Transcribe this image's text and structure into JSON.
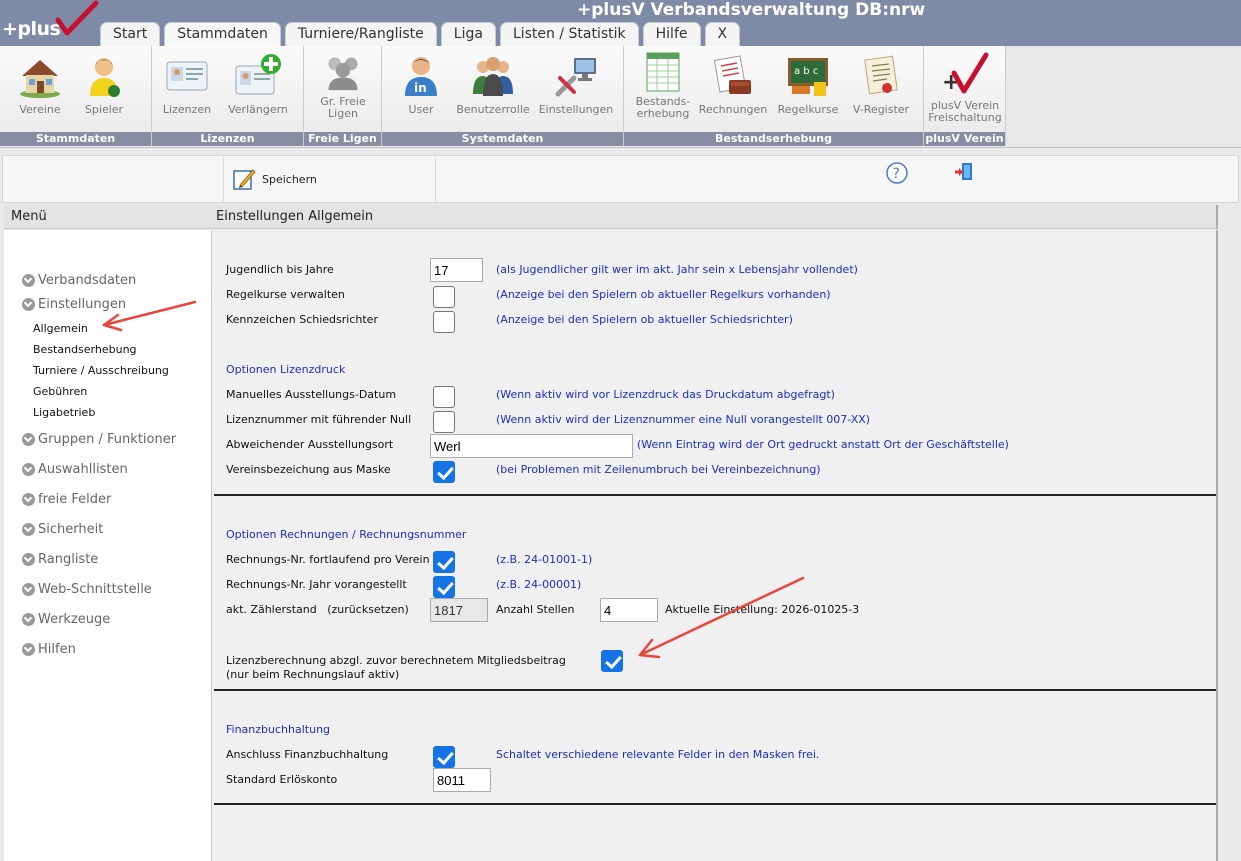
{
  "app": {
    "logo_text": "+plus",
    "title": "+plusV Verbandsverwaltung DB:nrw"
  },
  "tabs": [
    "Start",
    "Stammdaten",
    "Turniere/Rangliste",
    "Liga",
    "Listen / Statistik",
    "Hilfe",
    "X"
  ],
  "ribbon": {
    "groups": [
      {
        "title": "Stammdaten",
        "items": [
          {
            "label": "Vereine",
            "icon": "house-icon"
          },
          {
            "label": "Spieler",
            "icon": "player-icon"
          }
        ]
      },
      {
        "title": "Lizenzen",
        "items": [
          {
            "label": "Lizenzen",
            "icon": "license-card-icon"
          },
          {
            "label": "Verlängern",
            "icon": "license-extend-icon"
          }
        ]
      },
      {
        "title": "Freie Ligen",
        "items": [
          {
            "label": "Gr. Freie Ligen",
            "icon": "group-icon"
          }
        ]
      },
      {
        "title": "Systemdaten",
        "items": [
          {
            "label": "User",
            "icon": "user-icon"
          },
          {
            "label": "Benutzerrolle",
            "icon": "user-roles-icon"
          },
          {
            "label": "Einstellungen",
            "icon": "settings-tools-icon"
          }
        ]
      },
      {
        "title": "Bestandserhebung",
        "items": [
          {
            "label": "Bestands-\nerhebung",
            "icon": "spreadsheet-icon"
          },
          {
            "label": "Rechnungen",
            "icon": "invoice-icon"
          },
          {
            "label": "Regelkurse",
            "icon": "chalkboard-icon"
          },
          {
            "label": "V-Register",
            "icon": "register-icon"
          }
        ]
      },
      {
        "title": "plusV Verein",
        "items": [
          {
            "label": "plusV Verein\nFreischaltung",
            "icon": "plusv-logo-icon"
          }
        ]
      }
    ]
  },
  "toolbar": {
    "save_label": "Speichern"
  },
  "menu": {
    "header": "Menü",
    "items": [
      {
        "label": "Verbandsdaten"
      },
      {
        "label": "Einstellungen",
        "children": [
          "Allgemein",
          "Bestandserhebung",
          "Turniere / Ausschreibung",
          "Gebühren",
          "Ligabetrieb"
        ]
      },
      {
        "label": "Gruppen / Funktioner"
      },
      {
        "label": "Auswahllisten"
      },
      {
        "label": "freie Felder"
      },
      {
        "label": "Sicherheit"
      },
      {
        "label": "Rangliste"
      },
      {
        "label": "Web-Schnittstelle"
      },
      {
        "label": "Werkzeuge"
      },
      {
        "label": "Hilfen"
      }
    ]
  },
  "content": {
    "header": "Einstellungen Allgemein",
    "general": {
      "youth_age": {
        "label": "Jugendlich bis Jahre",
        "value": "17",
        "hint": "(als Jugendlicher gilt wer im akt. Jahr sein x Lebensjahr vollendet)"
      },
      "regelkurse": {
        "label": "Regelkurse verwalten",
        "checked": false,
        "hint": "(Anzeige bei den Spielern ob aktueller Regelkurs vorhanden)"
      },
      "referee": {
        "label": "Kennzeichen Schiedsrichter",
        "checked": false,
        "hint": "(Anzeige bei den Spielern ob aktueller Schiedsrichter)"
      }
    },
    "license_print": {
      "title": "Optionen Lizenzdruck",
      "manual_date": {
        "label": "Manuelles Ausstellungs-Datum",
        "checked": false,
        "hint": "(Wenn aktiv wird vor Lizenzdruck das Druckdatum abgefragt)"
      },
      "leading_zero": {
        "label": "Lizenznummer mit führender Null",
        "checked": false,
        "hint": "(Wenn aktiv wird der Lizenznummer eine Null vorangestellt 007-XX)"
      },
      "place": {
        "label": "Abweichender Ausstellungsort",
        "value": "Werl",
        "hint": "(Wenn Eintrag wird der Ort gedruckt anstatt Ort der Geschäftstelle)"
      },
      "club_name": {
        "label": "Vereinsbezeichung aus Maske",
        "checked": true,
        "hint": "(bei Problemen mit Zeilenumbruch bei Vereinbezeichnung)"
      }
    },
    "invoices": {
      "title": "Optionen Rechnungen / Rechnungsnummer",
      "per_club": {
        "label": "Rechnungs-Nr. fortlaufend pro Verein",
        "checked": true,
        "hint": "(z.B. 24-01001-1)"
      },
      "year_prefix": {
        "label": "Rechnungs-Nr. Jahr vorangestellt",
        "checked": true,
        "hint": "(z.B. 24-00001)"
      },
      "counter": {
        "label": "akt. Zählerstand   (zurücksetzen)",
        "value": "1817"
      },
      "digits": {
        "label": "Anzahl Stellen",
        "value": "4"
      },
      "current": "Aktuelle Einstellung: 2026-01025-3",
      "license_calc": {
        "label_line1": "Lizenzberechnung abzgl. zuvor berechnetem Mitgliedsbeitrag",
        "label_line2": "(nur beim Rechnungslauf aktiv)",
        "checked": true
      }
    },
    "finance": {
      "title": "Finanzbuchhaltung",
      "connect": {
        "label": "Anschluss Finanzbuchhaltung",
        "checked": true,
        "hint": "Schaltet verschiedene relevante Felder in den Masken frei."
      },
      "revenue_account": {
        "label": "Standard Erlöskonto",
        "value": "8011"
      }
    }
  },
  "colors": {
    "header_bg": "#7f8ba6",
    "accent_blue": "#1473e6",
    "hint_blue": "#1c2fc0",
    "arrow_red": "#e8463c"
  }
}
